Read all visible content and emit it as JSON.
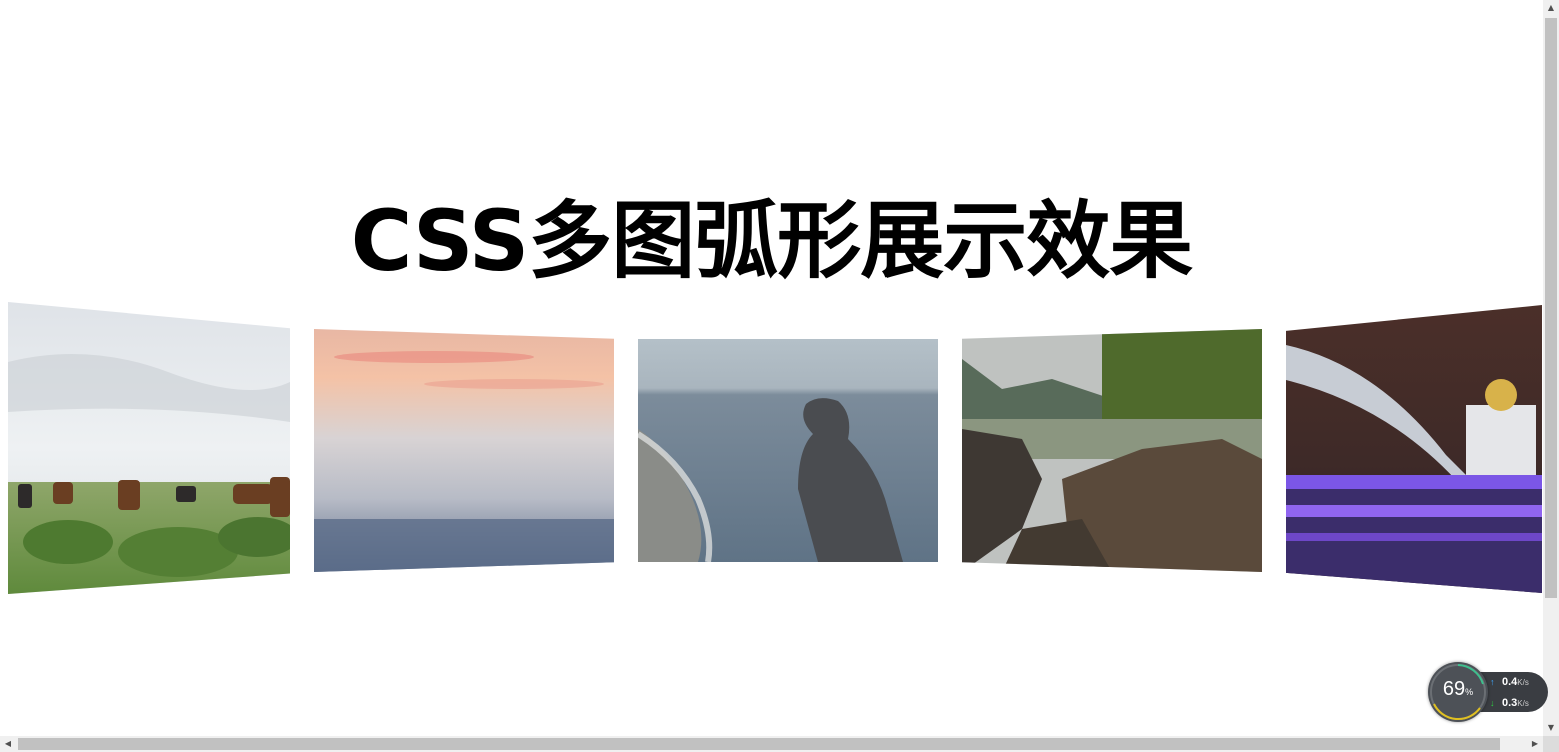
{
  "page": {
    "title": "CSS多图弧形展示效果"
  },
  "gallery": {
    "images": [
      {
        "label": "horses-on-grassland-photo"
      },
      {
        "label": "misty-sea-sunset-photo"
      },
      {
        "label": "hooded-person-by-sea-photo"
      },
      {
        "label": "rocky-river-forest-photo"
      },
      {
        "label": "night-bridge-cathedral-photo"
      }
    ]
  },
  "speed_widget": {
    "percent": "69",
    "percent_sign": "%",
    "upload_value": "0.4",
    "upload_unit": "K/s",
    "download_value": "0.3",
    "download_unit": "K/s",
    "colors": {
      "upload_arrow": "#3ea7ff",
      "download_arrow": "#2ecc40",
      "ring": "#e0c020"
    }
  }
}
